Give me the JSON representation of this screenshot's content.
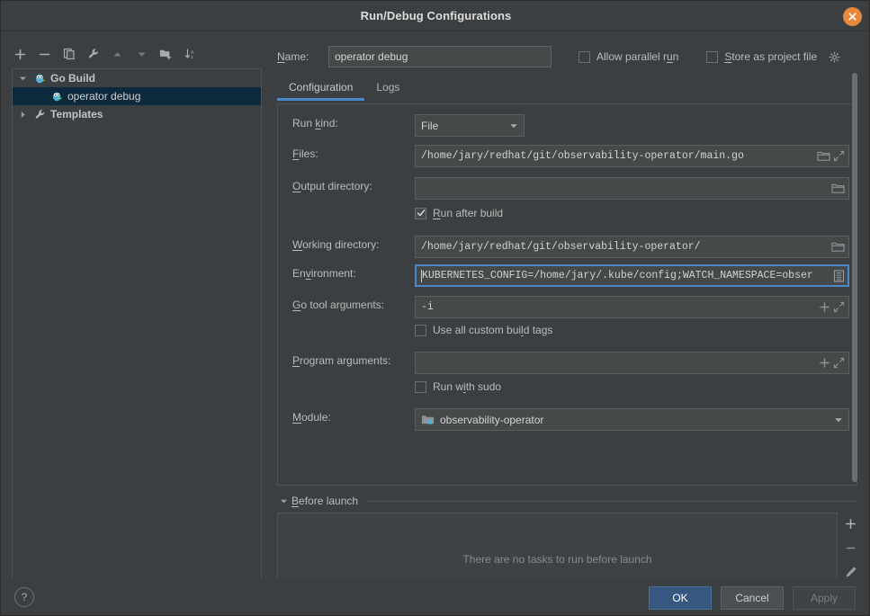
{
  "window": {
    "title": "Run/Debug Configurations",
    "close_label": "Close"
  },
  "colors": {
    "accent": "#4a88c7",
    "primary_button": "#365880",
    "close_button": "#e8883a",
    "selection": "#0d293e",
    "background": "#3c3f41",
    "field_background": "#45494a"
  },
  "tree_toolbar": [
    {
      "name": "add-configuration-button",
      "icon": "plus-icon"
    },
    {
      "name": "remove-configuration-button",
      "icon": "minus-icon"
    },
    {
      "name": "copy-configuration-button",
      "icon": "copy-icon"
    },
    {
      "name": "edit-templates-button",
      "icon": "wrench-icon"
    },
    {
      "name": "move-up-button",
      "icon": "arrow-up-icon"
    },
    {
      "name": "move-down-button",
      "icon": "arrow-down-icon"
    },
    {
      "name": "create-folder-button",
      "icon": "folder-add-icon"
    },
    {
      "name": "sort-configurations-button",
      "icon": "sort-az-icon"
    }
  ],
  "tree": {
    "items": [
      {
        "label": "Go Build",
        "icon": "go-gopher-icon",
        "type": "group",
        "expanded": true,
        "selected": false
      },
      {
        "label": "operator debug",
        "icon": "go-gopher-icon",
        "type": "leaf",
        "selected": true
      },
      {
        "label": "Templates",
        "icon": "wrench-icon",
        "type": "group",
        "expanded": false,
        "selected": false
      }
    ]
  },
  "header": {
    "name_label": "Name:",
    "name_value": "operator debug",
    "name_placeholder": "",
    "allow_parallel_run": {
      "label": "Allow parallel run",
      "checked": false
    },
    "store_as_project_file": {
      "label": "Store as project file",
      "checked": false
    },
    "settings_gear": "gear-icon"
  },
  "tabs": [
    {
      "label": "Configuration",
      "active": true
    },
    {
      "label": "Logs",
      "active": false
    }
  ],
  "form": {
    "run_kind": {
      "label": "Run kind:",
      "value": "File"
    },
    "files": {
      "label": "Files:",
      "value": "/home/jary/redhat/git/observability-operator/main.go",
      "icons": [
        "folder-icon",
        "expand-icon"
      ]
    },
    "output_directory": {
      "label": "Output directory:",
      "value": "",
      "icons": [
        "folder-icon"
      ]
    },
    "run_after_build": {
      "label": "Run after build",
      "checked": true
    },
    "working_directory": {
      "label": "Working directory:",
      "value": "/home/jary/redhat/git/observability-operator/",
      "icons": [
        "folder-icon"
      ]
    },
    "environment": {
      "label": "Environment:",
      "value": "KUBERNETES_CONFIG=/home/jary/.kube/config;WATCH_NAMESPACE=obser",
      "icons": [
        "environment-list-icon"
      ],
      "focused": true
    },
    "go_tool_arguments": {
      "label": "Go tool arguments:",
      "value": "-i",
      "icons": [
        "plus-icon",
        "expand-icon"
      ]
    },
    "use_all_custom_build_tags": {
      "label": "Use all custom build tags",
      "checked": false
    },
    "program_arguments": {
      "label": "Program arguments:",
      "value": "",
      "icons": [
        "plus-icon",
        "expand-icon"
      ]
    },
    "run_with_sudo": {
      "label": "Run with sudo",
      "checked": false
    },
    "module": {
      "label": "Module:",
      "value": "observability-operator",
      "icon": "module-folder-icon"
    }
  },
  "before_launch": {
    "title": "Before launch",
    "expanded": true,
    "empty_message": "There are no tasks to run before launch",
    "side_buttons": [
      {
        "name": "add-task-button",
        "icon": "plus-icon"
      },
      {
        "name": "remove-task-button",
        "icon": "minus-icon"
      },
      {
        "name": "edit-task-button",
        "icon": "pencil-icon"
      },
      {
        "name": "move-task-up-button",
        "icon": "arrow-up-icon"
      }
    ]
  },
  "footer": {
    "help_label": "?",
    "ok_label": "OK",
    "cancel_label": "Cancel",
    "apply_label": "Apply",
    "apply_disabled": true
  }
}
